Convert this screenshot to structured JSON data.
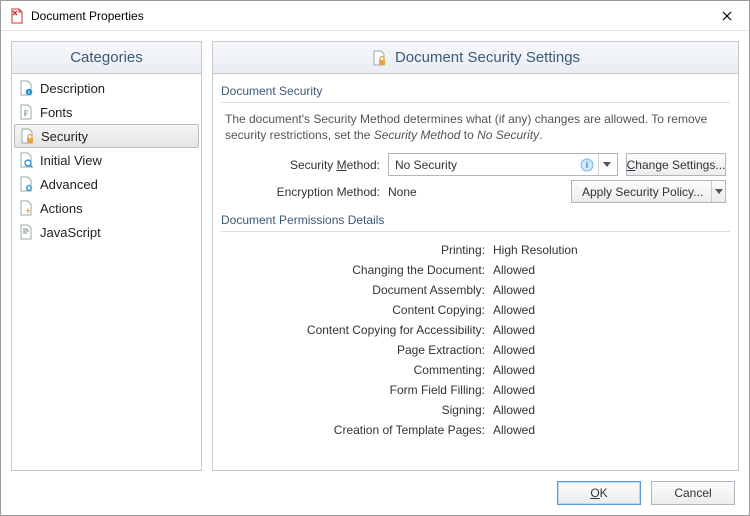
{
  "window": {
    "title": "Document Properties"
  },
  "categories": {
    "title": "Categories",
    "items": [
      {
        "label": "Description"
      },
      {
        "label": "Fonts"
      },
      {
        "label": "Security"
      },
      {
        "label": "Initial View"
      },
      {
        "label": "Advanced"
      },
      {
        "label": "Actions"
      },
      {
        "label": "JavaScript"
      }
    ],
    "selected_index": 2
  },
  "content": {
    "heading": "Document Security Settings",
    "security_group_label": "Document Security",
    "description_a": "The document's Security Method determines what (if any) changes are allowed. To remove security restrictions, set the ",
    "description_b": "Security Method",
    "description_c": " to ",
    "description_d": "No Security",
    "description_e": ".",
    "security_method_label_pre": "Security ",
    "security_method_label_u": "M",
    "security_method_label_post": "ethod:",
    "security_method_value": "No Security",
    "change_settings_pre": "",
    "change_settings_u": "C",
    "change_settings_post": "hange Settings...",
    "encryption_label": "Encryption Method:",
    "encryption_value": "None",
    "apply_policy": "Apply Security Policy...",
    "perm_group_label": "Document Permissions Details",
    "permissions": [
      {
        "key": "Printing:",
        "value": "High Resolution"
      },
      {
        "key": "Changing the Document:",
        "value": "Allowed"
      },
      {
        "key": "Document Assembly:",
        "value": "Allowed"
      },
      {
        "key": "Content Copying:",
        "value": "Allowed"
      },
      {
        "key": "Content Copying for Accessibility:",
        "value": "Allowed"
      },
      {
        "key": "Page Extraction:",
        "value": "Allowed"
      },
      {
        "key": "Commenting:",
        "value": "Allowed"
      },
      {
        "key": "Form Field Filling:",
        "value": "Allowed"
      },
      {
        "key": "Signing:",
        "value": "Allowed"
      },
      {
        "key": "Creation of Template Pages:",
        "value": "Allowed"
      }
    ]
  },
  "footer": {
    "ok_pre": "",
    "ok_u": "O",
    "ok_post": "K",
    "cancel": "Cancel"
  }
}
